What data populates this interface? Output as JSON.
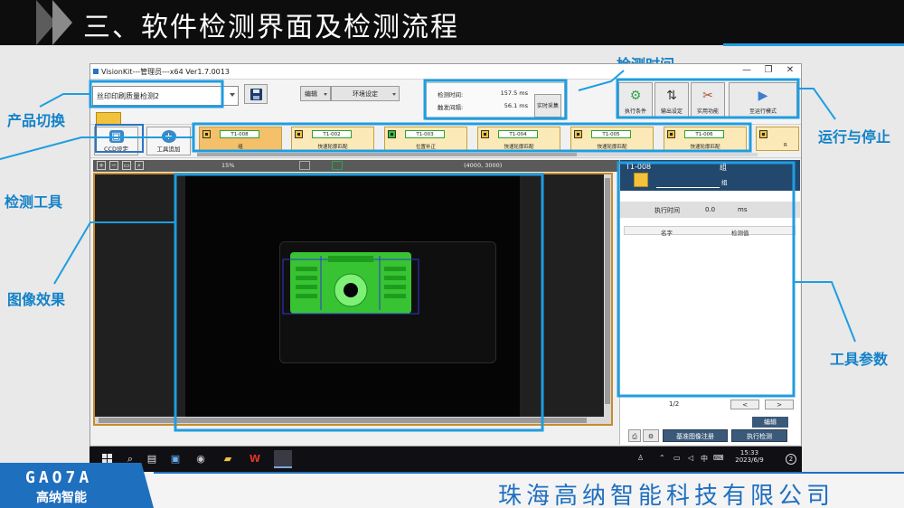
{
  "slide": {
    "title": "三、软件检测界面及检测流程",
    "annotations": {
      "product_switch": "产品切换",
      "detect_time": "检测时间",
      "run_stop": "运行与停止",
      "detect_tools": "检测工具",
      "image_effect": "图像效果",
      "tool_params": "工具参数"
    },
    "footer": {
      "brand": "GAO7A",
      "brand_cn": "高纳智能",
      "company": "珠海高纳智能科技有限公司"
    },
    "colors": {
      "accent": "#1f9de0",
      "annotation": "#1482c8"
    }
  },
  "window": {
    "title": "VisionKit---管理员---x64 Ver1.7.0013",
    "controls": [
      "—",
      "❐",
      "✕"
    ]
  },
  "toolbar": {
    "product_value": "丝印印刷质量检测2",
    "menu_edit": "编辑",
    "menu_env": "环境设定",
    "timing": {
      "detect_label": "检测时间:",
      "detect_value": "157.5 ms",
      "trigger_label": "触发间隔:",
      "trigger_value": "56.1 ms",
      "realtime_btn": "实时采集"
    },
    "run_buttons": {
      "exec": "执行条件",
      "output": "输出设定",
      "util": "实用功能",
      "run_mode": "至运行模式"
    }
  },
  "toolrow": {
    "ccd_btn": "CCD设定",
    "add_tool_btn": "工具追加",
    "tools": [
      {
        "code": "T1-008",
        "name": "组"
      },
      {
        "code": "T1-002",
        "name": "快速轮廓匹配"
      },
      {
        "code": "T1-003",
        "name": "位置补正"
      },
      {
        "code": "T1-004",
        "name": "快速轮廓匹配"
      },
      {
        "code": "T1-005",
        "name": "快速轮廓匹配"
      },
      {
        "code": "T1-006",
        "name": "快速轮廓匹配"
      }
    ],
    "partial_tool": "R"
  },
  "image": {
    "zoom": "15%",
    "resolution": "(4000, 3000)"
  },
  "right_panel": {
    "code": "T1-008",
    "type": "组",
    "name": "组",
    "exec_label": "执行时间",
    "exec_value": "0.0",
    "exec_unit": "ms",
    "col_name": "名字",
    "col_value": "检测值",
    "page": "1/2",
    "prev": "<",
    "next": ">",
    "edit_btn": "编辑",
    "register_btn": "基准图像注册",
    "run_detect_btn": "执行检测"
  },
  "taskbar": {
    "ime": "中",
    "time": "15:33",
    "date": "2023/6/9",
    "notif": "2"
  }
}
